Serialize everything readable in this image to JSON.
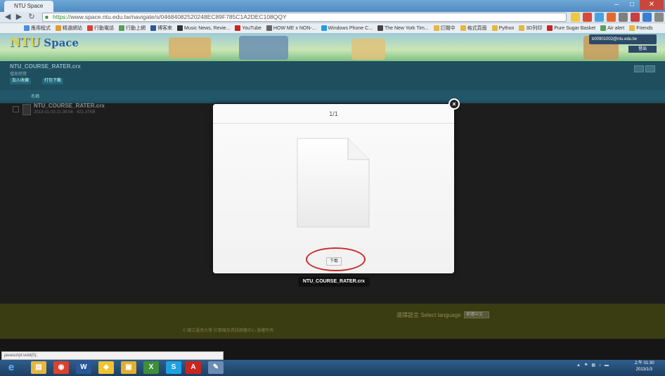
{
  "browser": {
    "tab_title": "NTU Space",
    "url_scheme": "https://",
    "url_rest": "www.space.ntu.edu.tw/navigate/s/04684082520248EC89F785C1A2DEC108QQY",
    "bookmarks": [
      "應用程式",
      "精選網站",
      "行動電話",
      "行動上網",
      "博客來",
      "Music News, Revie...",
      "YouTube",
      "HOW ME x NON-...",
      "Windows Phone C...",
      "The New York Tim...",
      "訂閱中",
      "格式頁面",
      "Python",
      "3D列印",
      "Pure Sugar Basket",
      "Air alert",
      "Friends"
    ]
  },
  "site": {
    "logo_ntu": "NTU",
    "logo_space": "Space",
    "user_email": "b00901002@ntu.edu.tw",
    "user_action": "登出"
  },
  "folder": {
    "title": "NTU_COURSE_RATER.crx",
    "subtitle": "檔案總覽",
    "btn_add": "加入收藏",
    "btn_download": "打包下載",
    "list_header": "名稱",
    "file_name": "NTU_COURSE_RATER.crx",
    "file_meta": "2013-01-03 21:39:04  ·  421.37KB"
  },
  "modal": {
    "counter": "1/1",
    "download_label": "下載",
    "filename_caption": "NTU_COURSE_RATER.crx",
    "close_symbol": "×"
  },
  "footer": {
    "language_label": "選擇語言 Select language",
    "language_value": "繁體中文",
    "copyright": "© 國立臺灣大學 計算機及資訊網路中心 版權所有"
  },
  "status_tip": "javascript:void(0);",
  "taskbar": {
    "clock_time": "上午 01:30",
    "clock_date": "2013/1/3",
    "apps": [
      "Internet Explorer",
      "File Explorer",
      "Chrome",
      "Word",
      "Picasa",
      "Photo Viewer",
      "Excel",
      "Skype",
      "Acrobat",
      "Paint"
    ]
  },
  "colors": {
    "accent_red": "#cc2a2a",
    "header_teal": "#1f4e5e",
    "footer_olive": "#3a3c12"
  }
}
